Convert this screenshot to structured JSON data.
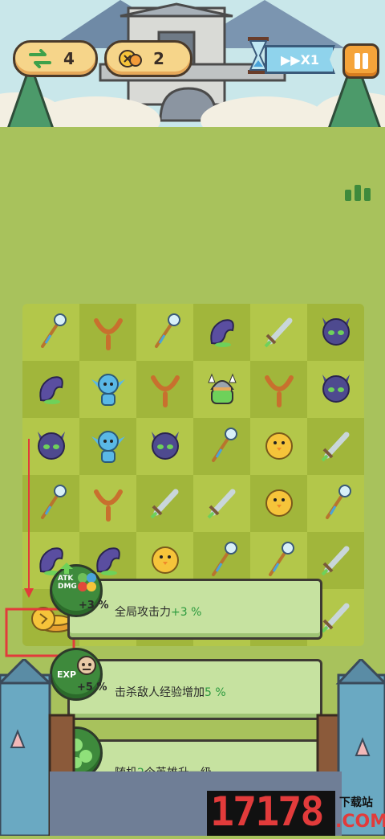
{
  "hud": {
    "swap_count": "4",
    "coin_count": "2",
    "speed_label": "▶▶X1"
  },
  "bonuses": [
    {
      "badge_pct": "+3 %",
      "prefix": "全局攻击力",
      "value": "+3 %",
      "suffix": ""
    },
    {
      "badge_pct": "+5 %",
      "prefix": "击杀敌人经验增加",
      "value": "5 %",
      "suffix": ""
    },
    {
      "badge_pct": "",
      "prefix": "随机",
      "value": "2",
      "suffix": "个英雄升一级"
    }
  ],
  "badge_labels": {
    "atk": "ATK",
    "dmg": "DMG",
    "exp": "EXP"
  },
  "board": {
    "rows": [
      [
        "staff",
        "slingshot",
        "staff",
        "tentacle",
        "sword",
        "demon"
      ],
      [
        "tentacle",
        "goblin",
        "slingshot",
        "viking",
        "slingshot",
        "demon"
      ],
      [
        "demon",
        "goblin",
        "demon",
        "staff",
        "chick",
        "sword"
      ],
      [
        "staff",
        "slingshot",
        "sword",
        "sword",
        "chick",
        "staff"
      ],
      [
        "tentacle",
        "tentacle",
        "chick",
        "staff",
        "staff",
        "sword"
      ],
      [
        "coins",
        "",
        "",
        "",
        "",
        "sword"
      ]
    ]
  },
  "watermark": {
    "digits": "17178",
    "site": "下载站",
    "domain": ".COM"
  },
  "colors": {
    "field": "#a8c25c",
    "board_light": "#b3c74a",
    "board_dark": "#a1b63b",
    "highlight_red": "#e23b3b",
    "card_green": "#c6e2a0",
    "value_green": "#2c9a3e"
  }
}
